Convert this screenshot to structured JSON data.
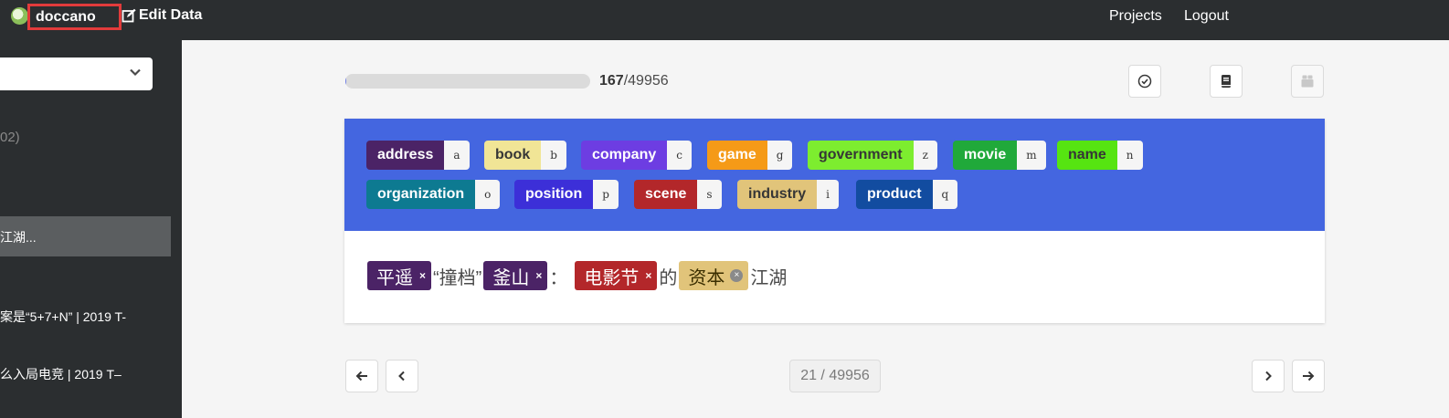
{
  "navbar": {
    "brand": "doccano",
    "edit_data": "Edit Data",
    "projects": "Projects",
    "logout": "Logout"
  },
  "sidebar": {
    "count_fragment": "02)",
    "items": [
      {
        "text": "江湖...",
        "active": true
      },
      {
        "text": "案是“5+7+N” | 2019 T-",
        "active": false
      },
      {
        "text": "么入局电竞 | 2019 T–",
        "active": false
      }
    ]
  },
  "progress": {
    "done": "167",
    "total": "/49956",
    "fraction": 0.0033
  },
  "toolbar_icons": [
    "check-circle-icon",
    "book-icon",
    "box-icon"
  ],
  "labels": [
    {
      "name": "address",
      "key": "a",
      "color": "#4b2366"
    },
    {
      "name": "book",
      "key": "b",
      "color": "#f1e596"
    },
    {
      "name": "company",
      "key": "c",
      "color": "#6d3de2"
    },
    {
      "name": "game",
      "key": "g",
      "color": "#f59a17"
    },
    {
      "name": "government",
      "key": "z",
      "color": "#7ded2f"
    },
    {
      "name": "movie",
      "key": "m",
      "color": "#20a93a"
    },
    {
      "name": "name",
      "key": "n",
      "color": "#56e411"
    },
    {
      "name": "organization",
      "key": "o",
      "color": "#0d7a91"
    },
    {
      "name": "position",
      "key": "p",
      "color": "#3c2fd8"
    },
    {
      "name": "scene",
      "key": "s",
      "color": "#b3272a"
    },
    {
      "name": "industry",
      "key": "i",
      "color": "#e1c47a"
    },
    {
      "name": "product",
      "key": "q",
      "color": "#124ca0"
    }
  ],
  "document": {
    "segments": [
      {
        "type": "entity",
        "text": "平遥",
        "label": "address",
        "color": "#4b2366",
        "remove": "×"
      },
      {
        "type": "text",
        "text": "“撞档”"
      },
      {
        "type": "entity",
        "text": "釜山",
        "label": "address",
        "color": "#4b2366",
        "remove": "×"
      },
      {
        "type": "text",
        "text": "："
      },
      {
        "type": "entity",
        "text": "电影节",
        "label": "scene",
        "color": "#b3272a",
        "remove": "×"
      },
      {
        "type": "text",
        "text": "的"
      },
      {
        "type": "entity",
        "text": "资本",
        "label": "industry",
        "color": "#e1c47a",
        "remove": "×"
      },
      {
        "type": "text",
        "text": "江湖"
      }
    ]
  },
  "pagination": {
    "counter": "21 / 49956"
  }
}
